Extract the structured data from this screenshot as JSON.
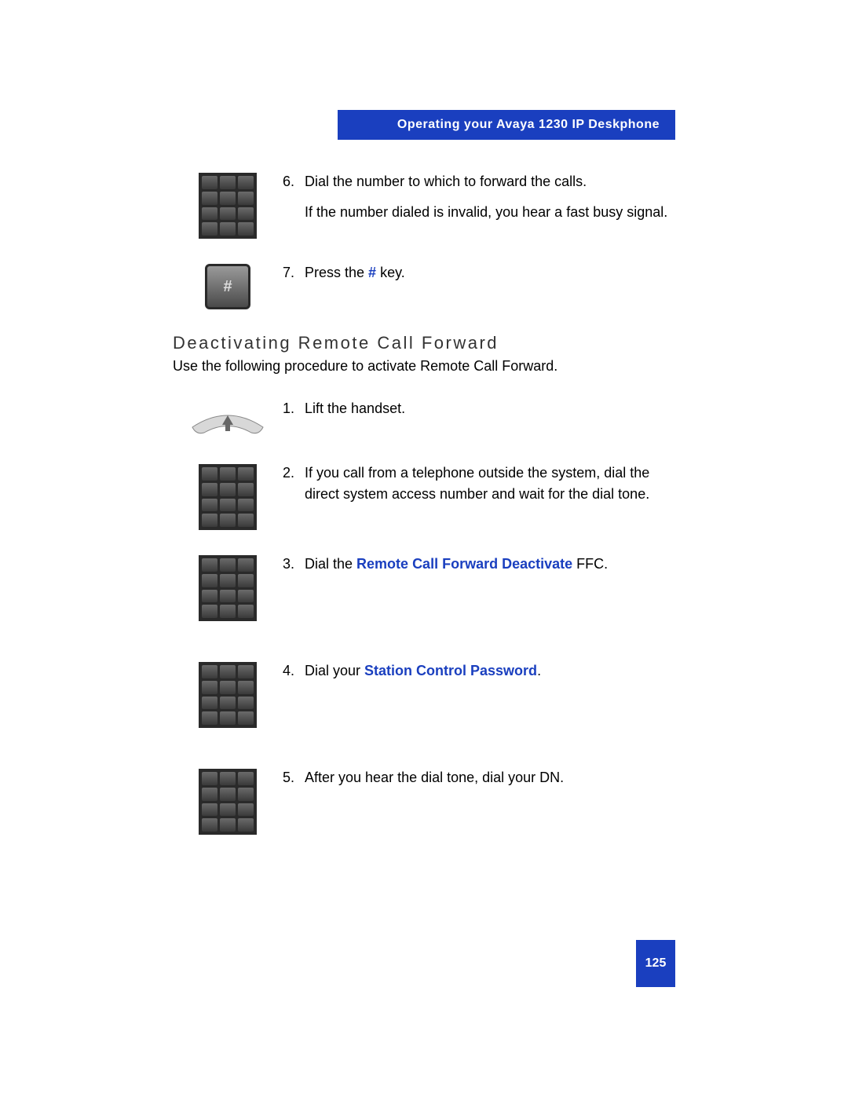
{
  "header": {
    "title": "Operating your Avaya 1230 IP Deskphone"
  },
  "topSteps": [
    {
      "icon": "keypad-icon",
      "num": "6.",
      "text": "Dial the number to which to forward the calls.",
      "sub": "If the number dialed is invalid, you hear a fast busy signal."
    },
    {
      "icon": "hash-key-icon",
      "num": "7.",
      "pre": "Press the ",
      "bold": "#",
      "post": " key."
    }
  ],
  "section": {
    "heading": "Deactivating Remote Call Forward",
    "subtext": "Use the following procedure to activate Remote Call Forward."
  },
  "steps": [
    {
      "icon": "handset-icon",
      "num": "1.",
      "text": "Lift the handset."
    },
    {
      "icon": "keypad-icon",
      "num": "2.",
      "text": "If you call from a telephone outside the system, dial the direct system access number and wait for the dial tone."
    },
    {
      "icon": "keypad-icon",
      "num": "3.",
      "pre": "Dial the ",
      "bold": "Remote Call Forward Deactivate",
      "post": " FFC."
    },
    {
      "icon": "keypad-icon",
      "num": "4.",
      "pre": "Dial your ",
      "bold": "Station Control Password",
      "post": "."
    },
    {
      "icon": "keypad-icon",
      "num": "5.",
      "text": "After you hear the dial tone, dial your DN."
    }
  ],
  "pageNumber": "125"
}
